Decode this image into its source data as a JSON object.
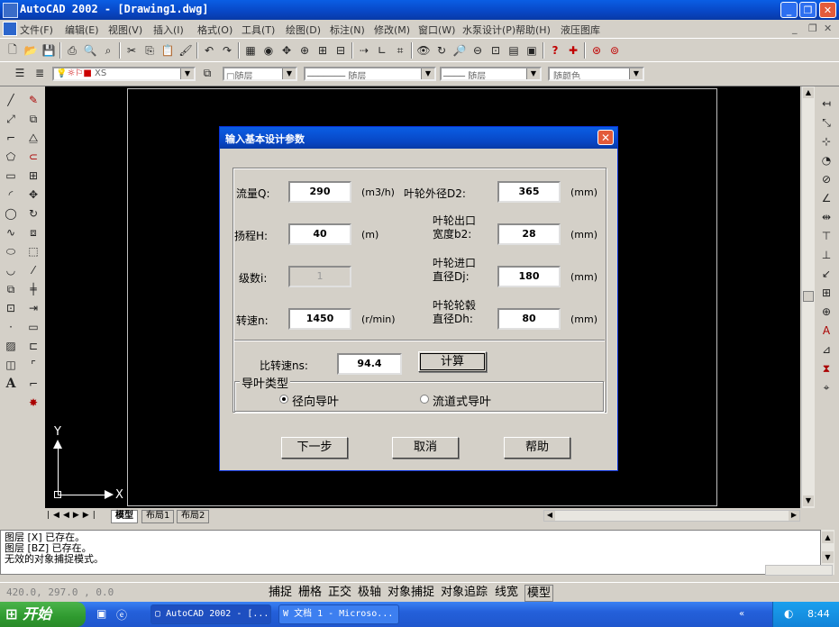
{
  "window": {
    "title": "AutoCAD 2002 - [Drawing1.dwg]"
  },
  "menu": [
    "文件(F)",
    "编辑(E)",
    "视图(V)",
    "插入(I)",
    "格式(O)",
    "工具(T)",
    "绘图(D)",
    "标注(N)",
    "修改(M)",
    "窗口(W)",
    "水泵设计(P)",
    "帮助(H)",
    "液压图库"
  ],
  "layer_bar": {
    "layer_name": "XS",
    "layer_combo": "随层",
    "linetype": "随层",
    "lineweight": "随层",
    "plotstyle": "随颜色"
  },
  "dialog": {
    "title": "输入基本设计参数",
    "flow_label": "流量Q:",
    "flow_value": "290",
    "flow_unit": "(m3/h)",
    "head_label": "扬程H:",
    "head_value": "40",
    "head_unit": "(m)",
    "stages_label": "级数i:",
    "stages_value": "1",
    "speed_label": "转速n:",
    "speed_value": "1450",
    "speed_unit": "(r/min)",
    "d2_label": "叶轮外径D2:",
    "d2_value": "365",
    "d2_unit": "(mm)",
    "b2_label_1": "叶轮出口",
    "b2_label_2": "宽度b2:",
    "b2_value": "28",
    "b2_unit": "(mm)",
    "dj_label_1": "叶轮进口",
    "dj_label_2": "直径Dj:",
    "dj_value": "180",
    "dj_unit": "(mm)",
    "dh_label_1": "叶轮轮毂",
    "dh_label_2": "直径Dh:",
    "dh_value": "80",
    "dh_unit": "(mm)",
    "ns_label": "比转速ns:",
    "ns_value": "94.4",
    "calc_button": "计算",
    "guide_group": "导叶类型",
    "radio_radial": "径向导叶",
    "radio_channel": "流道式导叶",
    "next_button": "下一步",
    "cancel_button": "取消",
    "help_button": "帮助"
  },
  "tabs": [
    "模型",
    "布局1",
    "布局2"
  ],
  "axes": {
    "y": "Y",
    "x": "X"
  },
  "command_lines": [
    "图层 [X] 已存在。",
    "图层 [BZ] 已存在。",
    "无效的对象捕捉模式。"
  ],
  "status": {
    "coords": "420.0, 297.0 , 0.0",
    "buttons": [
      "捕捉",
      "栅格",
      "正交",
      "极轴",
      "对象捕捉",
      "对象追踪",
      "线宽",
      "模型"
    ]
  },
  "taskbar": {
    "start": "开始",
    "tasks": [
      "AutoCAD 2002 - [...",
      "文档 1 - Microso..."
    ],
    "clock": "8:44"
  }
}
